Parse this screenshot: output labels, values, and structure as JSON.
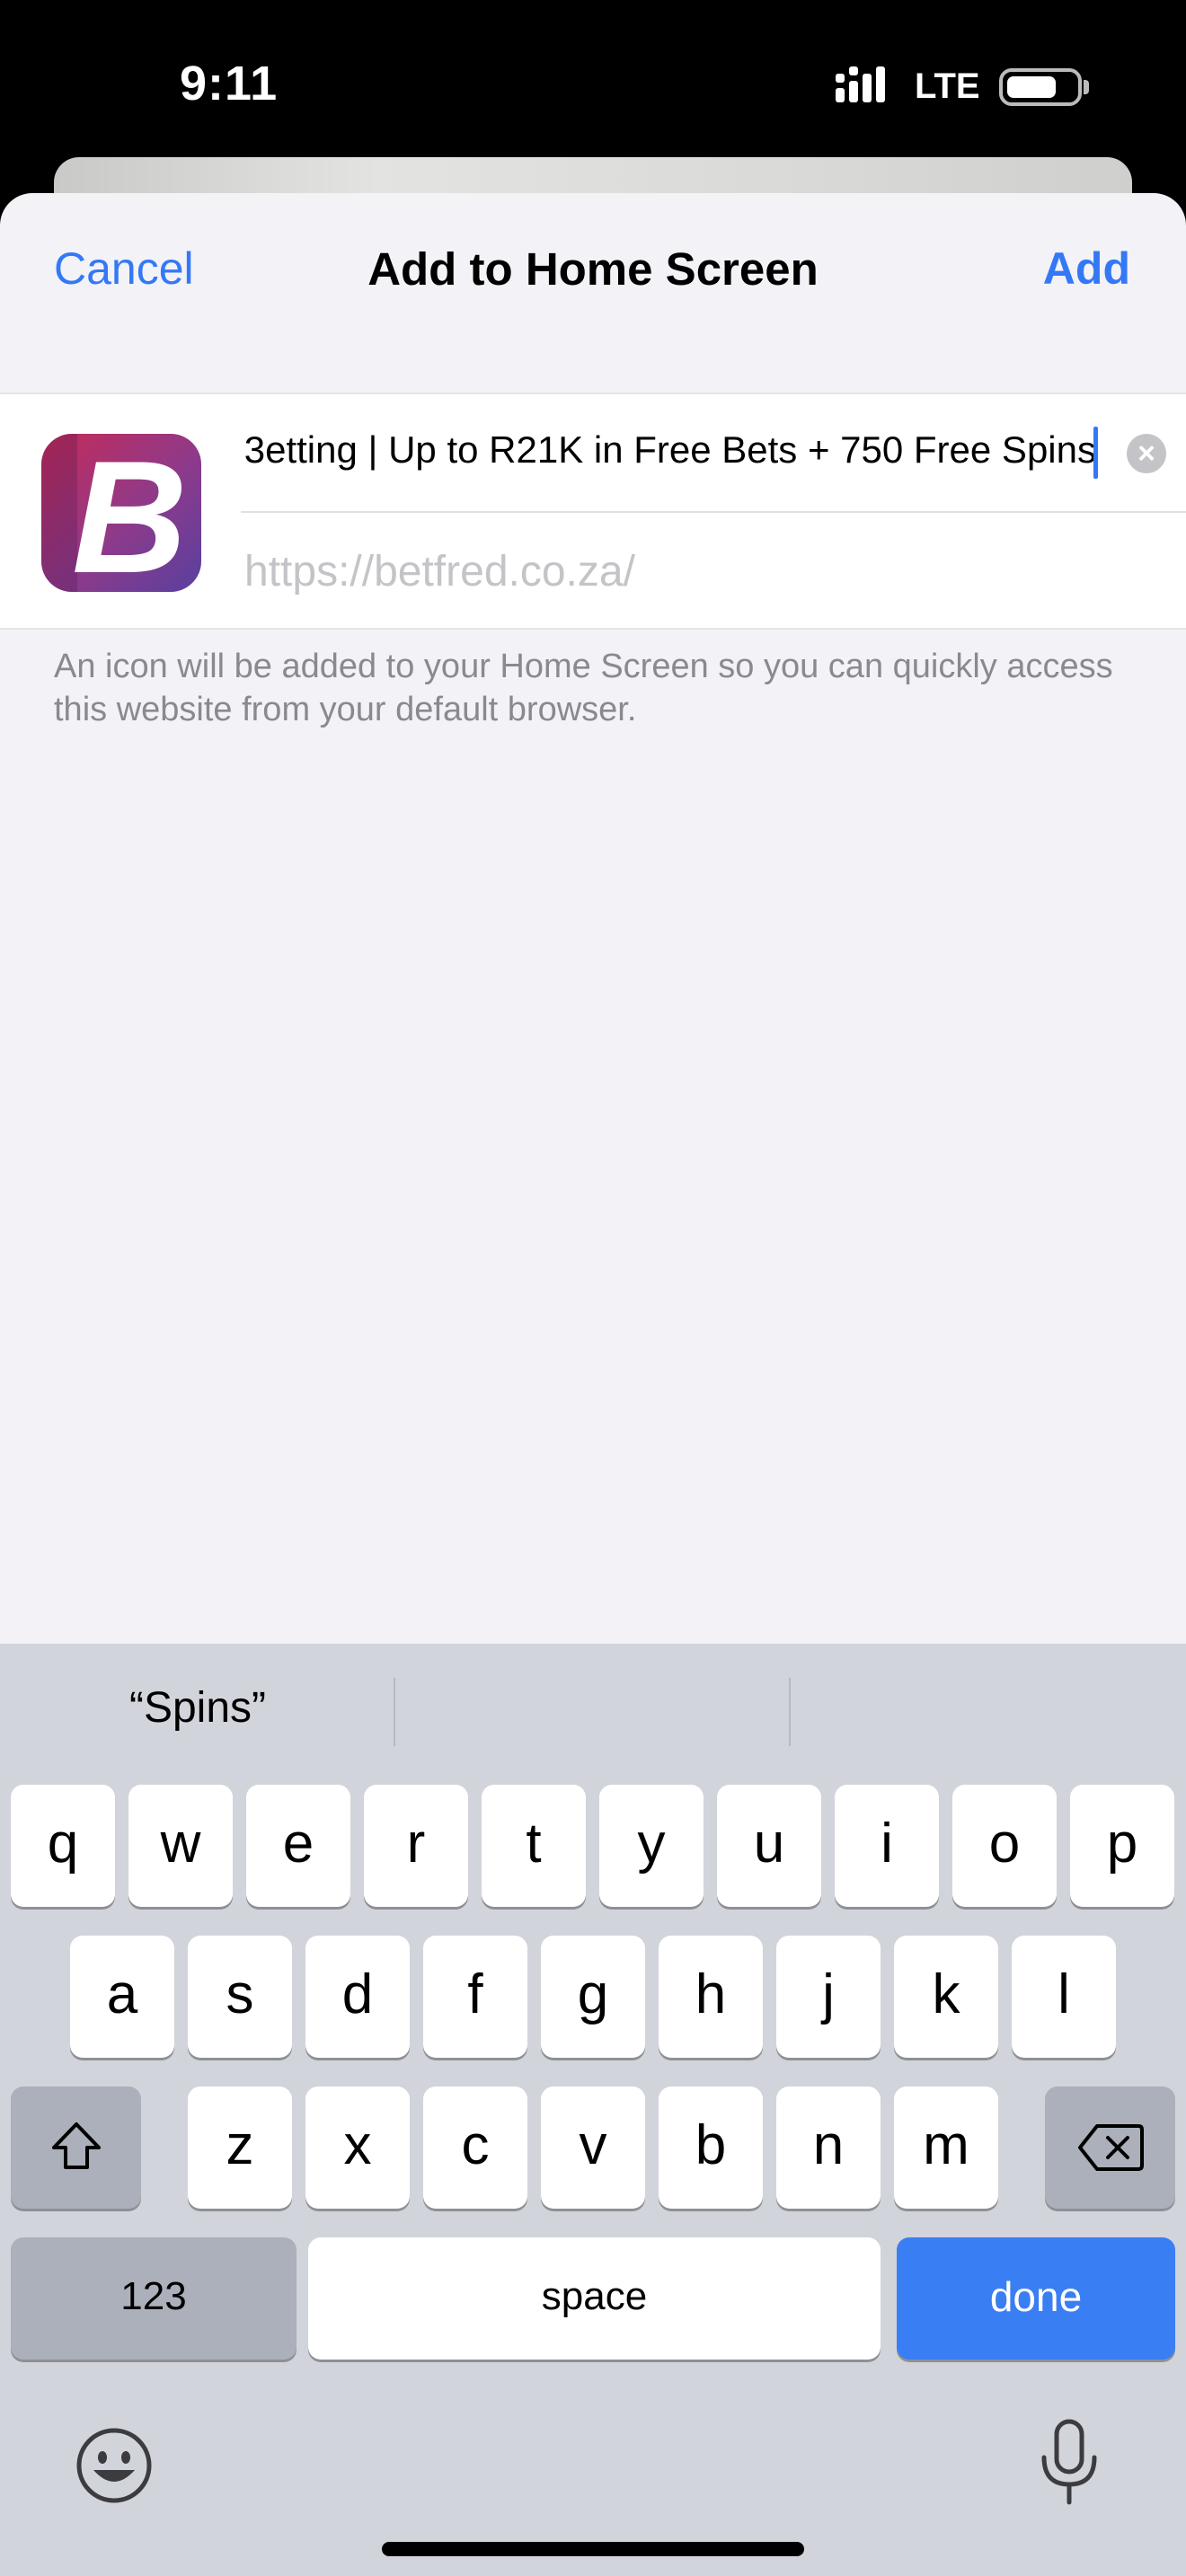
{
  "status_bar": {
    "time": "9:11",
    "network": "LTE"
  },
  "nav": {
    "cancel_label": "Cancel",
    "title": "Add to Home Screen",
    "add_label": "Add"
  },
  "bookmark": {
    "title_value": "Betting | Up to R21K in Free Bets + 750 Free Spins",
    "title_visible": "3etting | Up to R21K in Free Bets + 750 Free Spins",
    "url": "https://betfred.co.za/",
    "icon_letter": "B",
    "icon_colors": [
      "#c72a58",
      "#8e3a8a",
      "#5840a0"
    ]
  },
  "hint": "An icon will be added to your Home Screen so you can quickly access this website from your default browser.",
  "keyboard": {
    "suggestions": [
      "“Spins”",
      "",
      ""
    ],
    "row1": [
      "q",
      "w",
      "e",
      "r",
      "t",
      "y",
      "u",
      "i",
      "o",
      "p"
    ],
    "row2": [
      "a",
      "s",
      "d",
      "f",
      "g",
      "h",
      "j",
      "k",
      "l"
    ],
    "row3": [
      "z",
      "x",
      "c",
      "v",
      "b",
      "n",
      "m"
    ],
    "numbers_label": "123",
    "space_label": "space",
    "done_label": "done",
    "accent_color": "#3a7ef3"
  },
  "icons": [
    "signal-icon",
    "battery-icon",
    "clear-text-icon",
    "shift-icon",
    "backspace-icon",
    "emoji-icon",
    "microphone-icon"
  ]
}
